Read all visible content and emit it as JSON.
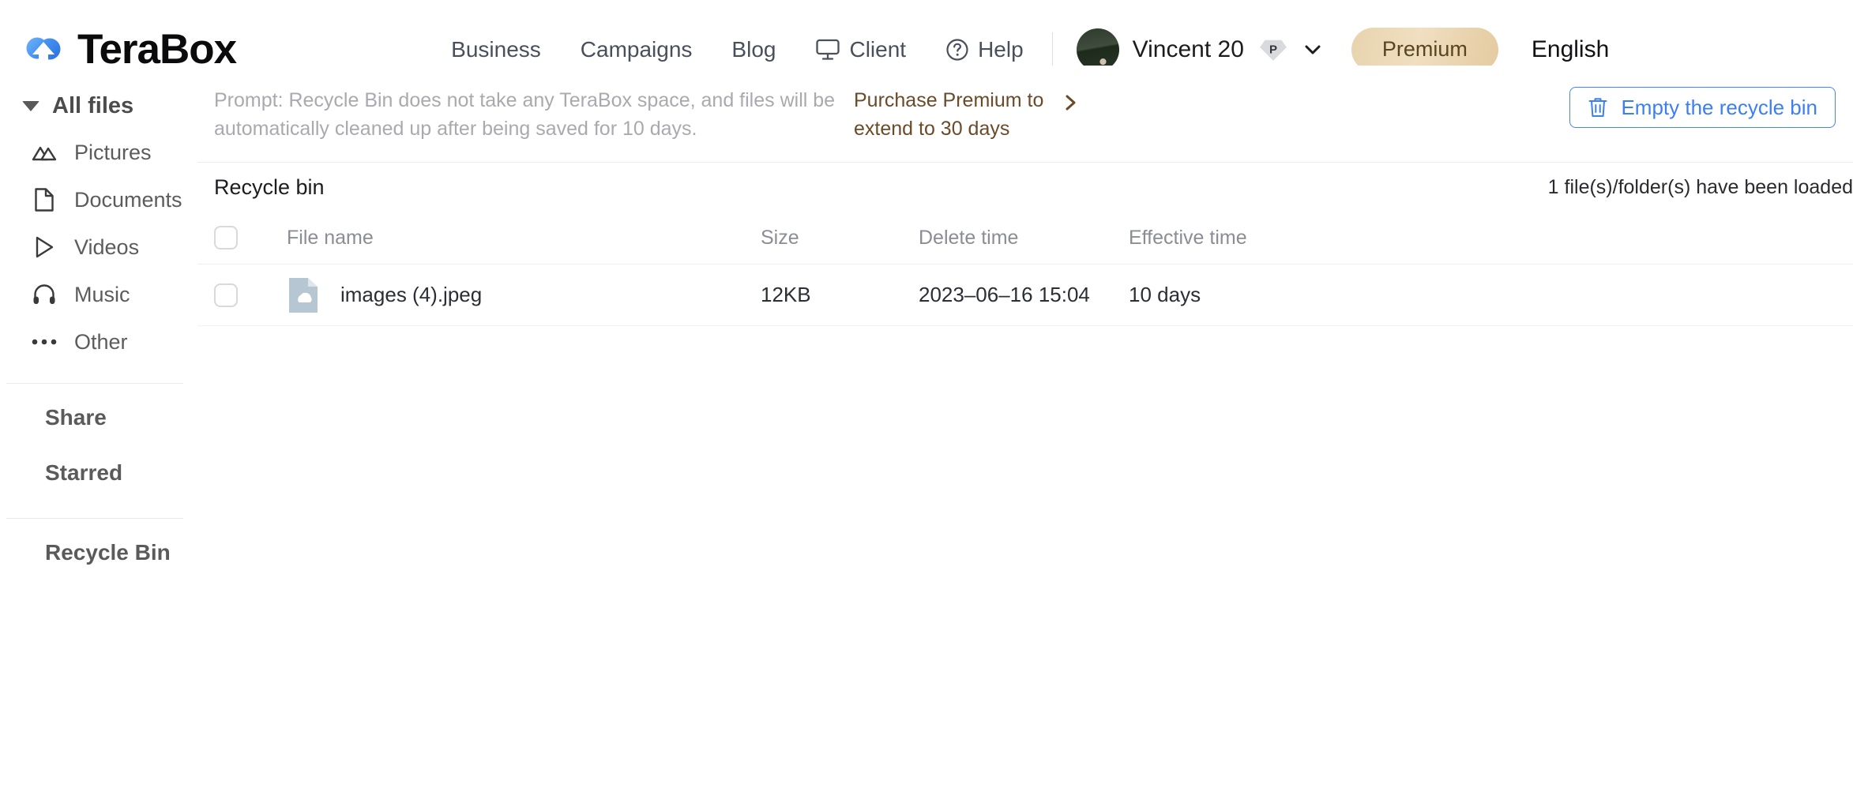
{
  "header": {
    "logo_text": "TeraBox",
    "logo_icon": "terabox-cloud-logo",
    "nav": [
      {
        "label": "Business",
        "icon": null
      },
      {
        "label": "Campaigns",
        "icon": null
      },
      {
        "label": "Blog",
        "icon": null
      },
      {
        "label": "Client",
        "icon": "monitor-icon"
      },
      {
        "label": "Help",
        "icon": "question-circle-icon"
      }
    ],
    "user": {
      "name": "Vincent 20",
      "avatar_icon": "user-avatar",
      "badge_label": "P",
      "badge_icon": "premium-diamond-badge",
      "chevron_icon": "chevron-down-icon"
    },
    "premium_label": "Premium",
    "language_label": "English"
  },
  "sidebar": {
    "all_files_label": "All files",
    "all_files_toggle_icon": "triangle-down-icon",
    "items": [
      {
        "label": "Pictures",
        "icon": "image-mountain-icon"
      },
      {
        "label": "Documents",
        "icon": "document-page-icon"
      },
      {
        "label": "Videos",
        "icon": "play-triangle-icon"
      },
      {
        "label": "Music",
        "icon": "headphones-icon"
      },
      {
        "label": "Other",
        "icon": "ellipsis-icon"
      }
    ],
    "groups": [
      {
        "label": "Share"
      },
      {
        "label": "Starred"
      },
      {
        "label": "Recycle Bin"
      }
    ]
  },
  "banner": {
    "prompt_text": "Prompt: Recycle Bin does not take any TeraBox space, and files will be automatically cleaned up after being saved for 10 days.",
    "upsell_text": "Purchase Premium to extend to 30 days",
    "upsell_chevron_icon": "chevron-right-icon",
    "empty_button_label": "Empty the recycle bin",
    "empty_button_icon": "trash-icon"
  },
  "content": {
    "title": "Recycle bin",
    "loaded_status": "1 file(s)/folder(s) have been loaded",
    "columns": {
      "name": "File name",
      "size": "Size",
      "delete_time": "Delete time",
      "effective_time": "Effective time"
    },
    "rows": [
      {
        "name": "images (4).jpeg",
        "size": "12KB",
        "delete_time": "2023–06–16 15:04",
        "effective_time": "10 days",
        "file_icon": "image-file-cloud-icon"
      }
    ]
  },
  "colors": {
    "brand_blue": "#3b7ff2",
    "premium_gold": "#e8d3ae",
    "premium_text": "#5b4520",
    "upsell_brown": "#6b4a28",
    "muted_gray": "#a9aab0"
  }
}
